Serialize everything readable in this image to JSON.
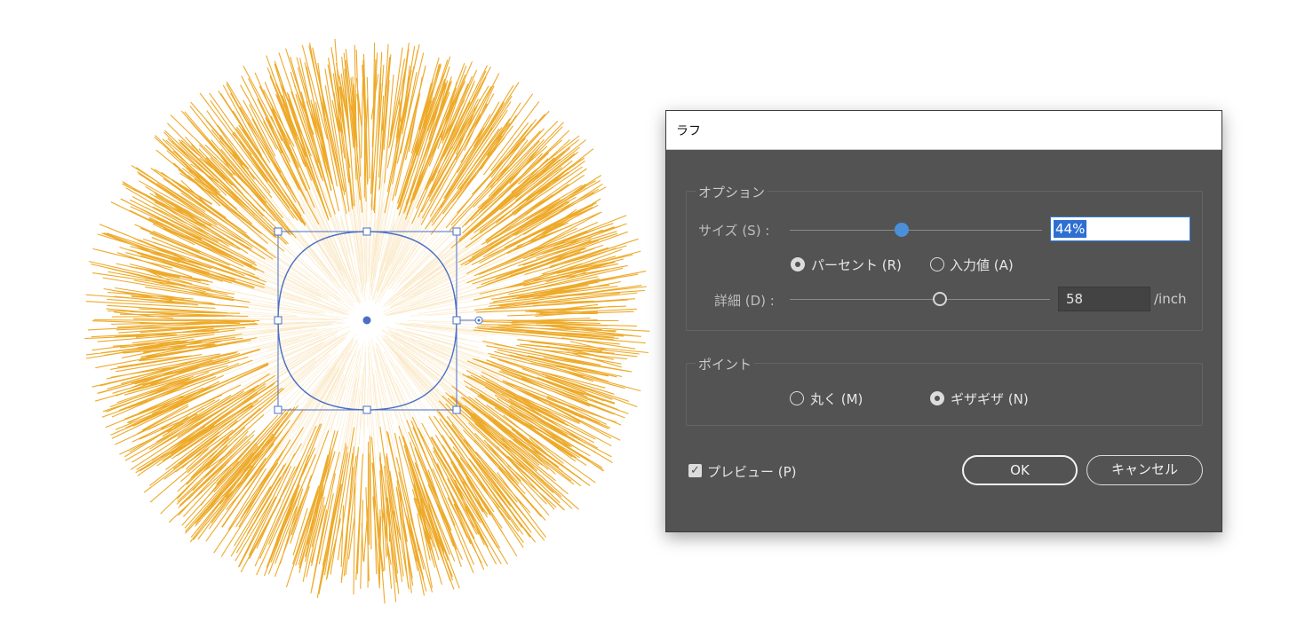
{
  "dialog": {
    "title": "ラフ",
    "options_group": {
      "label": "オプション",
      "size": {
        "label": "サイズ (S) :",
        "value": "44%",
        "slider_fraction": 0.44
      },
      "mode": {
        "percent_label": "パーセント (R)",
        "absolute_label": "入力値 (A)",
        "selected": "percent"
      },
      "detail": {
        "label": "詳細 (D) :",
        "value": "58",
        "unit": "/inch",
        "slider_fraction": 0.58
      }
    },
    "points_group": {
      "label": "ポイント",
      "smooth_label": "丸く (M)",
      "corner_label": "ギザギザ (N)",
      "selected": "corner"
    },
    "preview": {
      "label": "プレビュー (P)",
      "checked": true
    },
    "ok_label": "OK",
    "cancel_label": "キャンセル"
  },
  "artwork": {
    "stroke_color": "#eeaa2a",
    "selection_color": "#4a6fc4"
  }
}
